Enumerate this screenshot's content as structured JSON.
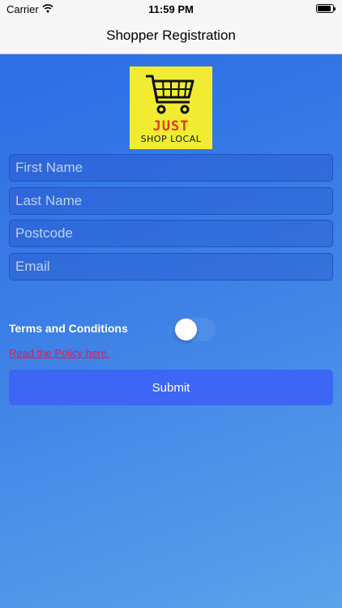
{
  "status_bar": {
    "carrier": "Carrier",
    "time": "11:59 PM"
  },
  "nav": {
    "title": "Shopper Registration"
  },
  "logo": {
    "line1": "JUST",
    "line2": "SHOP LOCAL"
  },
  "form": {
    "first_name_placeholder": "First Name",
    "last_name_placeholder": "Last Name",
    "postcode_placeholder": "Postcode",
    "email_placeholder": "Email",
    "terms_label": "Terms and Conditions",
    "terms_toggle_on": false,
    "policy_link": "Read the Policy here.",
    "submit_label": "Submit"
  },
  "colors": {
    "background_start": "#2b6ae6",
    "background_end": "#5aa3ea",
    "logo_background": "#f1ec32",
    "logo_accent": "#e23a1e",
    "link": "#e6194b",
    "submit_button": "#3d66f5"
  },
  "icons": {
    "wifi": "wifi-icon",
    "battery": "battery-icon",
    "cart": "shopping-cart-icon"
  }
}
